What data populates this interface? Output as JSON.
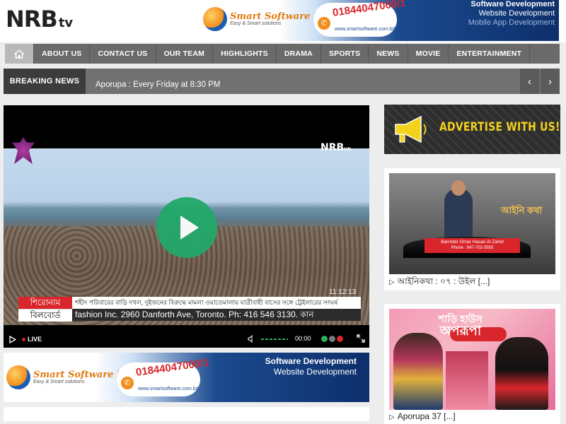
{
  "header": {
    "logo_main": "NRB",
    "logo_suffix": "tv",
    "banner": {
      "brand": "Smart Software Inc.",
      "tagline": "Easy & Smart solutions",
      "phone": "01844047000/1",
      "website": "www.smartsoftware.com.bd",
      "services": [
        "Software Development",
        "Website Development",
        "Mobile App Development"
      ]
    }
  },
  "nav": {
    "home_icon": "home-icon",
    "items": [
      "ABOUT US",
      "CONTACT US",
      "OUR TEAM",
      "HIGHLIGHTS",
      "DRAMA",
      "SPORTS",
      "NEWS",
      "MOVIE",
      "ENTERTAINMENT"
    ]
  },
  "breaking": {
    "label": "BREAKING NEWS",
    "headline": "Aporupa : Every Friday at 8:30 PM",
    "prev_icon": "chevron-left-icon",
    "next_icon": "chevron-right-icon"
  },
  "player": {
    "watermark": "NRB",
    "watermark_suffix": "HD",
    "clock": "11:12:13",
    "ticker_label_1": "শিরোনাম",
    "ticker_text_1": "শহীদ পরিবারের বাড়ি দখল, দুইজনের বিরুদ্ধে মামলা    ওয়াতেমালায় যাত্রীবাহী বাসের সঙ্গে ট্রেইলারের সংঘর্ষ",
    "ticker_label_2": "বিলবোর্ড",
    "ticker_text_2": "fashion Inc. 2960 Danforth Ave, Toronto. Ph: 416 546 3130.  কান",
    "live_label": "LIVE",
    "time": "00:00"
  },
  "bottom_banner": {
    "brand": "Smart Software Inc.",
    "tagline": "Easy & Smart solutions",
    "phone": "01844047000/1",
    "website": "www.smartsoftware.com.bd",
    "services": [
      "Software Development",
      "Website Development"
    ]
  },
  "sidebar": {
    "ad_text": "ADVERTISE WITH US!",
    "cards": [
      {
        "caption": "আইনিকথা : ০৭ : উইল [...]",
        "show_title": "আইনি কথা",
        "lower_third_name": "Barrister Omar Hasan Al Zahid",
        "lower_third_phone": "Phone : 647-702-3593"
      },
      {
        "caption": "Aporupa 37 [...]",
        "show_title_top": "শাড়ি হাউস",
        "show_title_main": "অপরূপা"
      }
    ]
  },
  "colors": {
    "nav_bg": "#6a6a6a",
    "breaking_bg": "#717171",
    "brand_red": "#d9262c",
    "play_green": "#22a86a",
    "ad_yellow": "#f2d21b"
  }
}
